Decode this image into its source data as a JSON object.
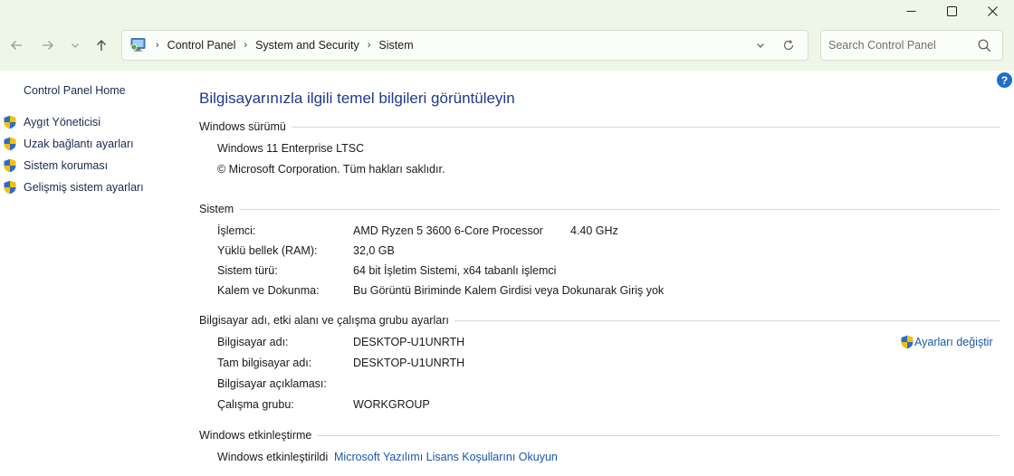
{
  "window": {
    "minimize_icon": "minimize-icon",
    "maximize_icon": "maximize-icon",
    "close_icon": "close-icon"
  },
  "nav": {
    "back_icon": "arrow-left-icon",
    "forward_icon": "arrow-right-icon",
    "recent_icon": "chevron-down-icon",
    "up_icon": "arrow-up-icon"
  },
  "address": {
    "crumbs": [
      "Control Panel",
      "System and Security",
      "Sistem"
    ]
  },
  "search": {
    "placeholder": "Search Control Panel"
  },
  "left_pane": {
    "home": "Control Panel Home",
    "items": [
      "Aygıt Yöneticisi",
      "Uzak bağlantı ayarları",
      "Sistem koruması",
      "Gelişmiş sistem ayarları"
    ]
  },
  "main": {
    "title": "Bilgisayarınızla ilgili temel bilgileri görüntüleyin",
    "help": "?",
    "edition": {
      "heading": "Windows sürümü",
      "name": "Windows 11 Enterprise LTSC",
      "copyright": "© Microsoft Corporation. Tüm hakları saklıdır."
    },
    "system": {
      "heading": "Sistem",
      "rows": [
        {
          "label": "İşlemci:",
          "value": "AMD Ryzen 5 3600 6-Core Processor",
          "extra": "4.40 GHz"
        },
        {
          "label": "Yüklü bellek (RAM):",
          "value": "32,0 GB"
        },
        {
          "label": "Sistem türü:",
          "value": "64 bit İşletim Sistemi, x64 tabanlı işlemci"
        },
        {
          "label": "Kalem ve Dokunma:",
          "value": "Bu Görüntü Biriminde Kalem Girdisi veya Dokunarak Giriş yok"
        }
      ]
    },
    "computer": {
      "heading": "Bilgisayar adı, etki alanı ve çalışma grubu ayarları",
      "change_link": "Ayarları değiştir",
      "rows": [
        {
          "label": "Bilgisayar adı:",
          "value": "DESKTOP-U1UNRTH"
        },
        {
          "label": "Tam bilgisayar adı:",
          "value": "DESKTOP-U1UNRTH"
        },
        {
          "label": "Bilgisayar açıklaması:",
          "value": ""
        },
        {
          "label": "Çalışma grubu:",
          "value": "WORKGROUP"
        }
      ]
    },
    "activation": {
      "heading": "Windows etkinleştirme",
      "status": "Windows etkinleştirildi",
      "link": "Microsoft Yazılımı Lisans Koşullarını Okuyun"
    }
  },
  "colors": {
    "accent": "#1e3a8a",
    "link": "#1a56a8",
    "topbar_bg": "#eef6e8"
  }
}
